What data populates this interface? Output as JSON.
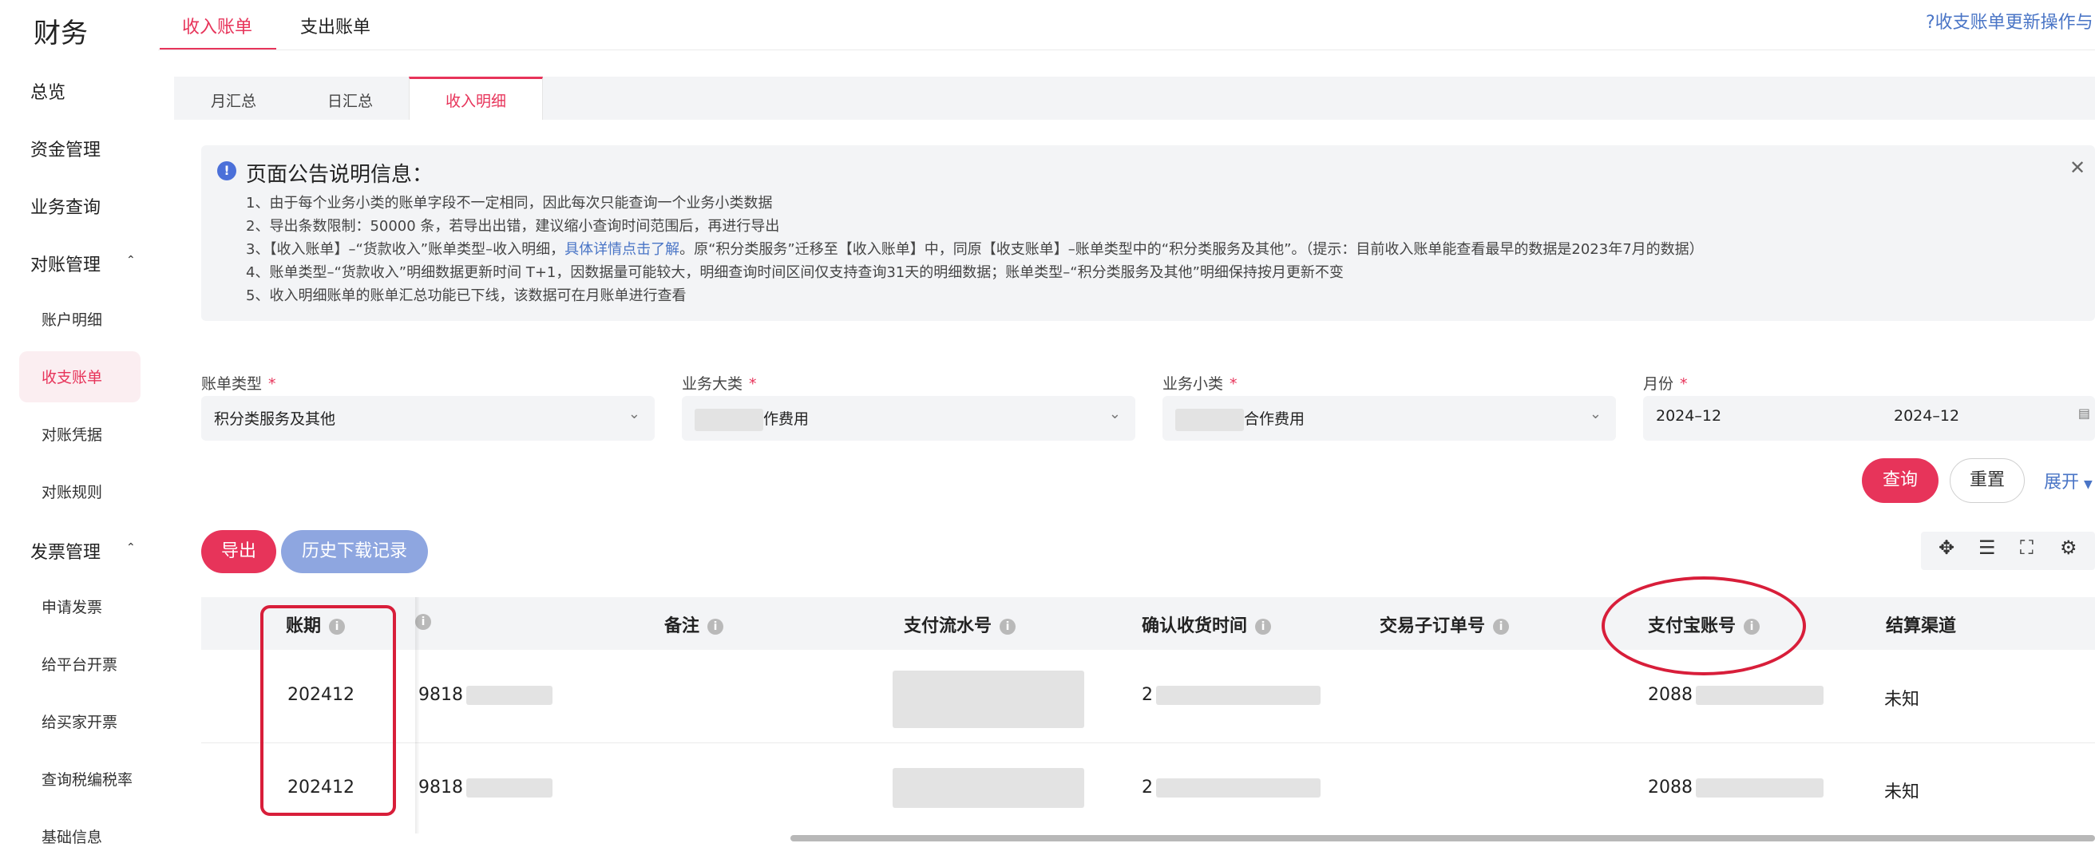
{
  "sidebar": {
    "title": "财务",
    "items": [
      {
        "label": "总览"
      },
      {
        "label": "资金管理"
      },
      {
        "label": "业务查询"
      },
      {
        "label": "对账管理",
        "expanded": true
      },
      {
        "label": "发票管理",
        "expanded": true
      }
    ],
    "reconcile_children": [
      {
        "label": "账户明细"
      },
      {
        "label": "收支账单",
        "active": true
      },
      {
        "label": "对账凭据"
      },
      {
        "label": "对账规则"
      }
    ],
    "invoice_children": [
      {
        "label": "申请发票"
      },
      {
        "label": "给平台开票"
      },
      {
        "label": "给买家开票"
      },
      {
        "label": "查询税编税率"
      },
      {
        "label": "基础信息"
      }
    ]
  },
  "top_tabs": [
    {
      "label": "收入账单",
      "active": true
    },
    {
      "label": "支出账单"
    }
  ],
  "help_link": "?收支账单更新操作与",
  "sub_tabs": [
    {
      "label": "月汇总"
    },
    {
      "label": "日汇总"
    },
    {
      "label": "收入明细",
      "active": true
    }
  ],
  "notice": {
    "title": "页面公告说明信息：",
    "line1": "1、由于每个业务小类的账单字段不一定相同，因此每次只能查询一个业务小类数据",
    "line2": "2、导出条数限制：50000 条，若导出出错，建议缩小查询时间范围后，再进行导出",
    "line3_pre": "3、【收入账单】–“货款收入”账单类型–收入明细，",
    "line3_link": "具体详情点击了解",
    "line3_post": "。原“积分类服务”迁移至【收入账单】中，同原【收支账单】–账单类型中的“积分类服务及其他”。（提示：目前收入账单能查看最早的数据是2023年7月的数据）",
    "line4": "4、账单类型–“货款收入”明细数据更新时间 T+1，因数据量可能较大，明细查询时间区间仅支持查询31天的明细数据；账单类型–“积分类服务及其他”明细保持按月更新不变",
    "line5": "5、收入明细账单的账单汇总功能已下线，该数据可在月账单进行查看"
  },
  "filters": {
    "bill_type": {
      "label": "账单类型",
      "value": "积分类服务及其他"
    },
    "biz_category": {
      "label": "业务大类",
      "value_suffix": "作费用"
    },
    "biz_subcategory": {
      "label": "业务小类",
      "value_suffix": "合作费用"
    },
    "month": {
      "label": "月份",
      "start": "2024–12",
      "end": "2024–12"
    },
    "required_mark": "*"
  },
  "actions": {
    "query": "查询",
    "reset": "重置",
    "expand": "展开",
    "export": "导出",
    "history": "历史下载记录"
  },
  "table": {
    "columns": [
      "账期",
      "备注",
      "支付流水号",
      "确认收货时间",
      "交易子订单号",
      "支付宝账号",
      "结算渠道"
    ],
    "rows": [
      {
        "period": "202412",
        "col2_prefix": "9818",
        "confirm_prefix": "2",
        "alipay_prefix": "2088",
        "channel": "未知"
      },
      {
        "period": "202412",
        "col2_prefix": "9818",
        "confirm_prefix": "2",
        "alipay_prefix": "2088",
        "channel": "未知"
      }
    ]
  },
  "colors": {
    "accent": "#e7345a",
    "link": "#4a75c6",
    "annotation": "#d81e3a"
  }
}
